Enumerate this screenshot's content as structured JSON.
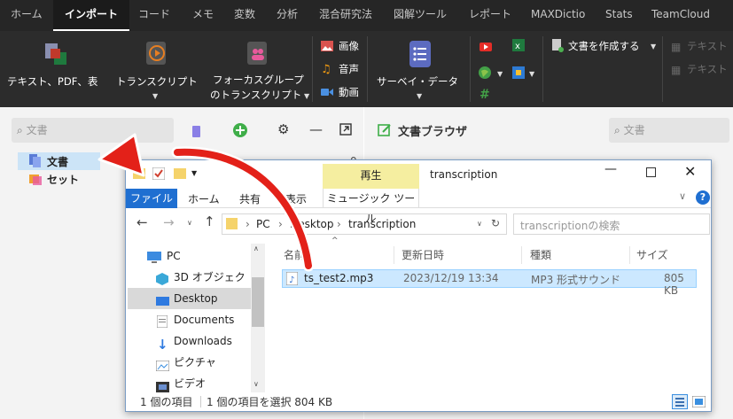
{
  "tabs": [
    "ホーム",
    "インポート",
    "コード",
    "メモ",
    "変数",
    "分析",
    "混合研究法",
    "図解ツール",
    "レポート",
    "MAXDictio",
    "Stats",
    "TeamCloud"
  ],
  "active_tab": "インポート",
  "ribbon": {
    "text_pdf": "テキスト、PDF、表",
    "transcript_l1": "トランスクリプト",
    "focus_l1": "フォーカスグループ",
    "focus_l2": "のトランスクリプト",
    "image": "画像",
    "audio": "音声",
    "video": "動画",
    "survey": "サーベイ・データ",
    "create_doc": "文書を作成する",
    "text_a": "テキスト",
    "text_b": "テキスト"
  },
  "left": {
    "search_placeholder": "文書",
    "tree_docs": "文書",
    "tree_sets": "セット",
    "count": "0"
  },
  "right": {
    "title": "文書ブラウザ",
    "search_placeholder": "文書"
  },
  "explorer": {
    "window_title": "transcription",
    "play_tab": "再生",
    "music_tools": "ミュージック ツール",
    "ribbon_tabs": [
      "ファイル",
      "ホーム",
      "共有",
      "表示"
    ],
    "path": [
      "PC",
      "Desktop",
      "transcription"
    ],
    "search_placeholder": "transcriptionの検索",
    "nav_items": [
      "PC",
      "3D オブジェクト",
      "Desktop",
      "Documents",
      "Downloads",
      "ピクチャ",
      "ビデオ"
    ],
    "columns": [
      "名前",
      "更新日時",
      "種類",
      "サイズ"
    ],
    "file": {
      "name": "ts_test2.mp3",
      "date": "2023/12/19 13:34",
      "type": "MP3 形式サウンド",
      "size": "805 KB"
    },
    "status_items": "1 個の項目",
    "status_selected": "1 個の項目を選択  804 KB"
  },
  "colors": {
    "accent_red": "#e32119",
    "selection": "#cce8ff",
    "tab_bg": "#262626",
    "ribbon_bg": "#2c2c2c",
    "play_tab": "#f5eea0"
  }
}
